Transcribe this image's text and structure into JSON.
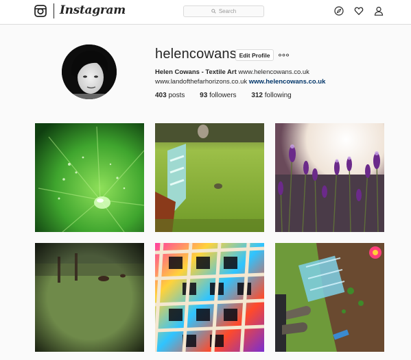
{
  "header": {
    "wordmark": "Instagram",
    "search": {
      "placeholder": "Search",
      "icon": "search-icon"
    },
    "icons": [
      "explore-compass-icon",
      "heart-icon",
      "profile-person-icon"
    ]
  },
  "profile": {
    "username": "helencowans",
    "edit_button": "Edit Profile",
    "more_icon": "more-options-icon",
    "full_name": "Helen Cowans - Textile Art",
    "website_inline": "www.helencowans.co.uk",
    "bio_line2": "www.landofthefarhorizons.co.uk",
    "website_link": "www.helencowans.co.uk",
    "stats": {
      "posts_count": "403",
      "posts_label": "posts",
      "followers_count": "93",
      "followers_label": "followers",
      "following_count": "312",
      "following_label": "following"
    }
  },
  "colors": {
    "background": "#fafafa",
    "text": "#262626",
    "link": "#003569",
    "border": "#dbdbdb"
  },
  "posts": [
    {
      "name": "post-green-leaf-dewdrop"
    },
    {
      "name": "post-garden-bench-lawn"
    },
    {
      "name": "post-purple-lavender"
    },
    {
      "name": "post-field-with-cows"
    },
    {
      "name": "post-colourful-grid"
    },
    {
      "name": "post-boots-plants-soil"
    }
  ]
}
